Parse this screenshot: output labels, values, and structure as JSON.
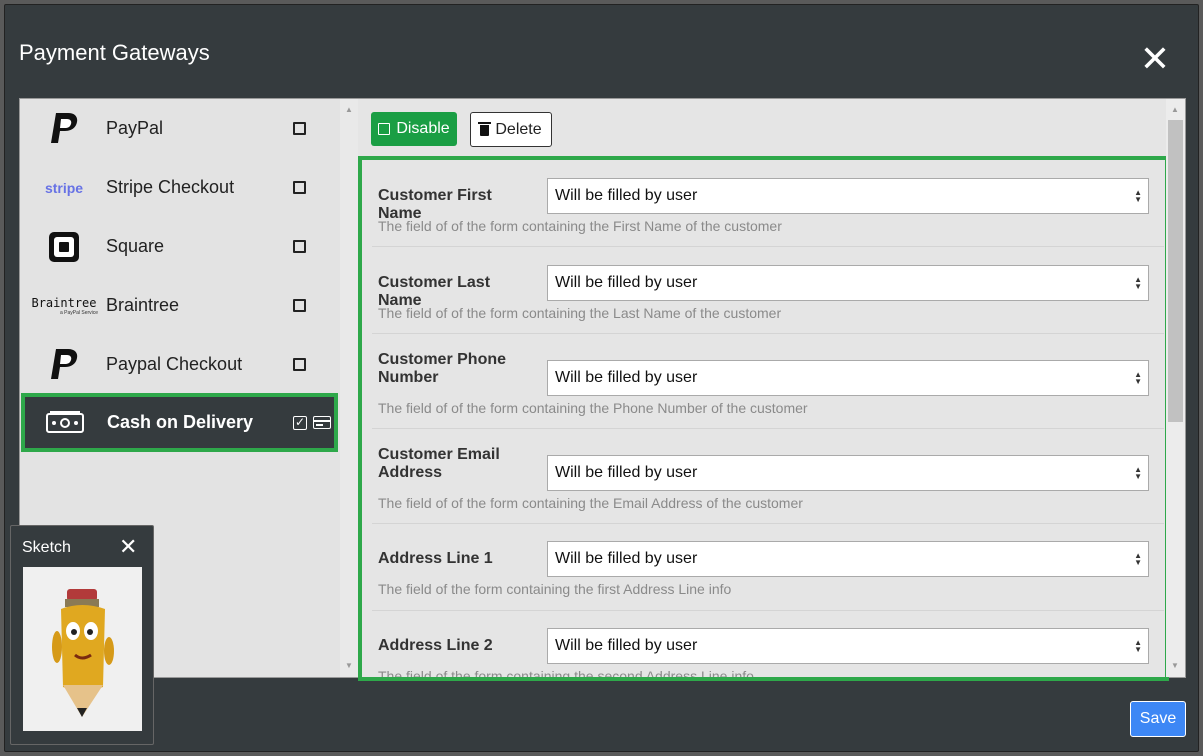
{
  "dialog": {
    "title": "Payment Gateways",
    "close_glyph": "✕"
  },
  "sidebar": {
    "items": [
      {
        "label": "PayPal",
        "icon": "paypal-logo"
      },
      {
        "label": "Stripe Checkout",
        "icon": "stripe-logo",
        "logo_text": "stripe"
      },
      {
        "label": "Square",
        "icon": "square-logo"
      },
      {
        "label": "Braintree",
        "icon": "braintree-logo",
        "logo_text": "Braintree",
        "logo_subtext": "a PayPal Service"
      },
      {
        "label": "Paypal Checkout",
        "icon": "paypal-logo"
      },
      {
        "label": "Cash on Delivery",
        "icon": "cash-icon",
        "active": true,
        "enabled": true
      }
    ]
  },
  "toolbar": {
    "disable_label": "Disable",
    "delete_label": "Delete"
  },
  "form": {
    "rows": [
      {
        "label": "Customer First Name",
        "value": "Will be filled by user",
        "help": "The field of of the form containing the First Name of the customer"
      },
      {
        "label": "Customer Last Name",
        "value": "Will be filled by user",
        "help": "The field of of the form containing the Last Name of the customer"
      },
      {
        "label": "Customer Phone Number",
        "value": "Will be filled by user",
        "help": "The field of of the form containing the Phone Number of the customer"
      },
      {
        "label": "Customer Email Address",
        "value": "Will be filled by user",
        "help": "The field of of the form containing the Email Address of the customer"
      },
      {
        "label": "Address Line 1",
        "value": "Will be filled by user",
        "help": "The field of the form containing the first Address Line info"
      },
      {
        "label": "Address Line 2",
        "value": "Will be filled by user",
        "help": "The field of the form containing the second Address Line info"
      }
    ]
  },
  "footer": {
    "save_label": "Save"
  },
  "sketch": {
    "title": "Sketch",
    "close_glyph": "✕",
    "image": "pencil-mascot"
  },
  "colors": {
    "accent_green": "#2ea84a",
    "disable_green": "#1a9e44",
    "save_blue": "#3d87f5",
    "dialog_bg": "#353b3e"
  }
}
